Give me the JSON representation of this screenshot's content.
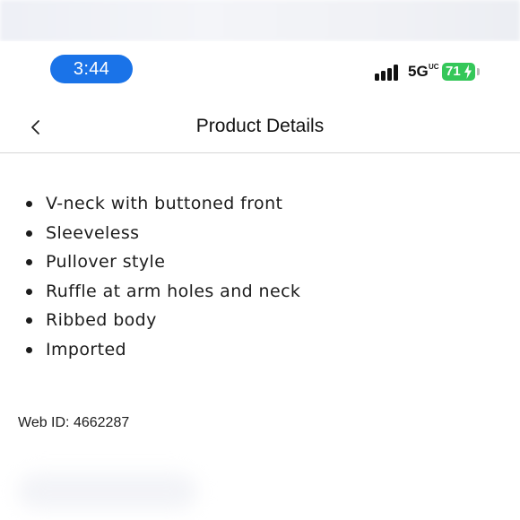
{
  "status_bar": {
    "time": "3:44",
    "network": "5G",
    "network_suffix": "UC",
    "battery_level": "71",
    "colors": {
      "time_pill": "#1a73e8",
      "battery": "#34c759"
    },
    "icons": [
      "signal-bars-icon",
      "battery-charging-icon"
    ]
  },
  "nav": {
    "title": "Product Details",
    "back_icon": "chevron-left-icon"
  },
  "details": {
    "items": [
      "V-neck with buttoned front",
      "Sleeveless",
      "Pullover style",
      "Ruffle at arm holes and neck",
      "Ribbed body",
      "Imported"
    ]
  },
  "web_id": "Web ID: 4662287"
}
